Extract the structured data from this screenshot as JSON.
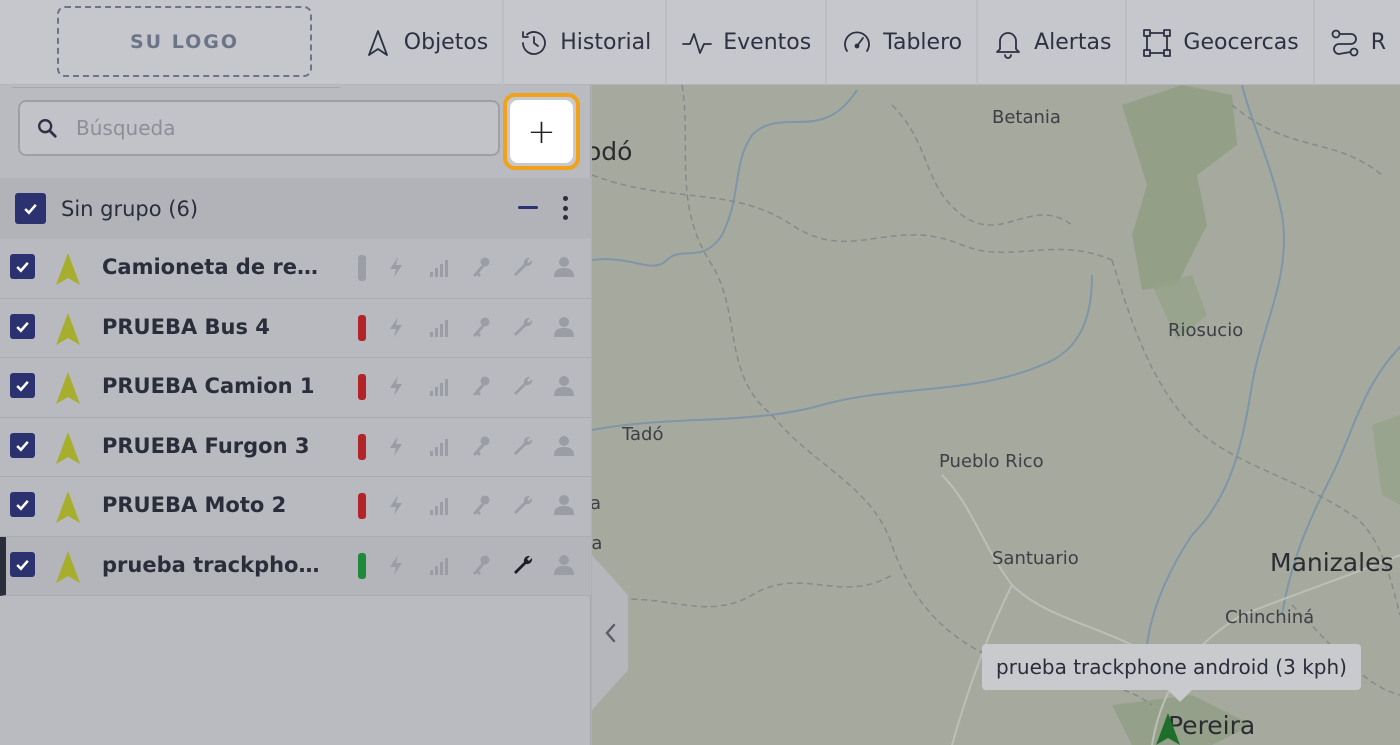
{
  "logo": {
    "text": "SU LOGO"
  },
  "nav": [
    {
      "label": "Objetos",
      "icon": "navigation-arrow-icon"
    },
    {
      "label": "Historial",
      "icon": "history-icon"
    },
    {
      "label": "Eventos",
      "icon": "activity-icon"
    },
    {
      "label": "Tablero",
      "icon": "gauge-icon"
    },
    {
      "label": "Alertas",
      "icon": "bell-icon"
    },
    {
      "label": "Geocercas",
      "icon": "geofence-icon"
    },
    {
      "label": "R",
      "icon": "route-icon"
    }
  ],
  "search": {
    "placeholder": "Búsqueda",
    "value": ""
  },
  "add_button": {
    "label": "+"
  },
  "group": {
    "label": "Sin grupo (6)"
  },
  "objects": [
    {
      "name": "Camioneta de rep...",
      "status_color": "#9b9ea4",
      "wrench_active": false
    },
    {
      "name": "PRUEBA Bus 4",
      "status_color": "#b3232a",
      "wrench_active": false
    },
    {
      "name": "PRUEBA Camion 1",
      "status_color": "#b3232a",
      "wrench_active": false
    },
    {
      "name": "PRUEBA Furgon 3",
      "status_color": "#b3232a",
      "wrench_active": false
    },
    {
      "name": "PRUEBA Moto 2",
      "status_color": "#b3232a",
      "wrench_active": false
    },
    {
      "name": "prueba trackphon...",
      "status_color": "#1f8a3a",
      "wrench_active": true
    }
  ],
  "map": {
    "places": [
      {
        "name": "odó"
      },
      {
        "name": "Betania"
      },
      {
        "name": "Riosucio"
      },
      {
        "name": "Tadó"
      },
      {
        "name": "Pueblo Rico"
      },
      {
        "name": "Santuario"
      },
      {
        "name": "Manizales"
      },
      {
        "name": "Chinchiná"
      },
      {
        "name": "Pereira"
      },
      {
        "name": "a"
      },
      {
        "name": "ra"
      }
    ],
    "tooltip": "prueba trackphone android (3 kph)"
  },
  "colors": {
    "accent": "#2c3170",
    "highlight": "#f0a21b",
    "arrow": "#a7ad2c",
    "marker": "#1f6e2b"
  }
}
